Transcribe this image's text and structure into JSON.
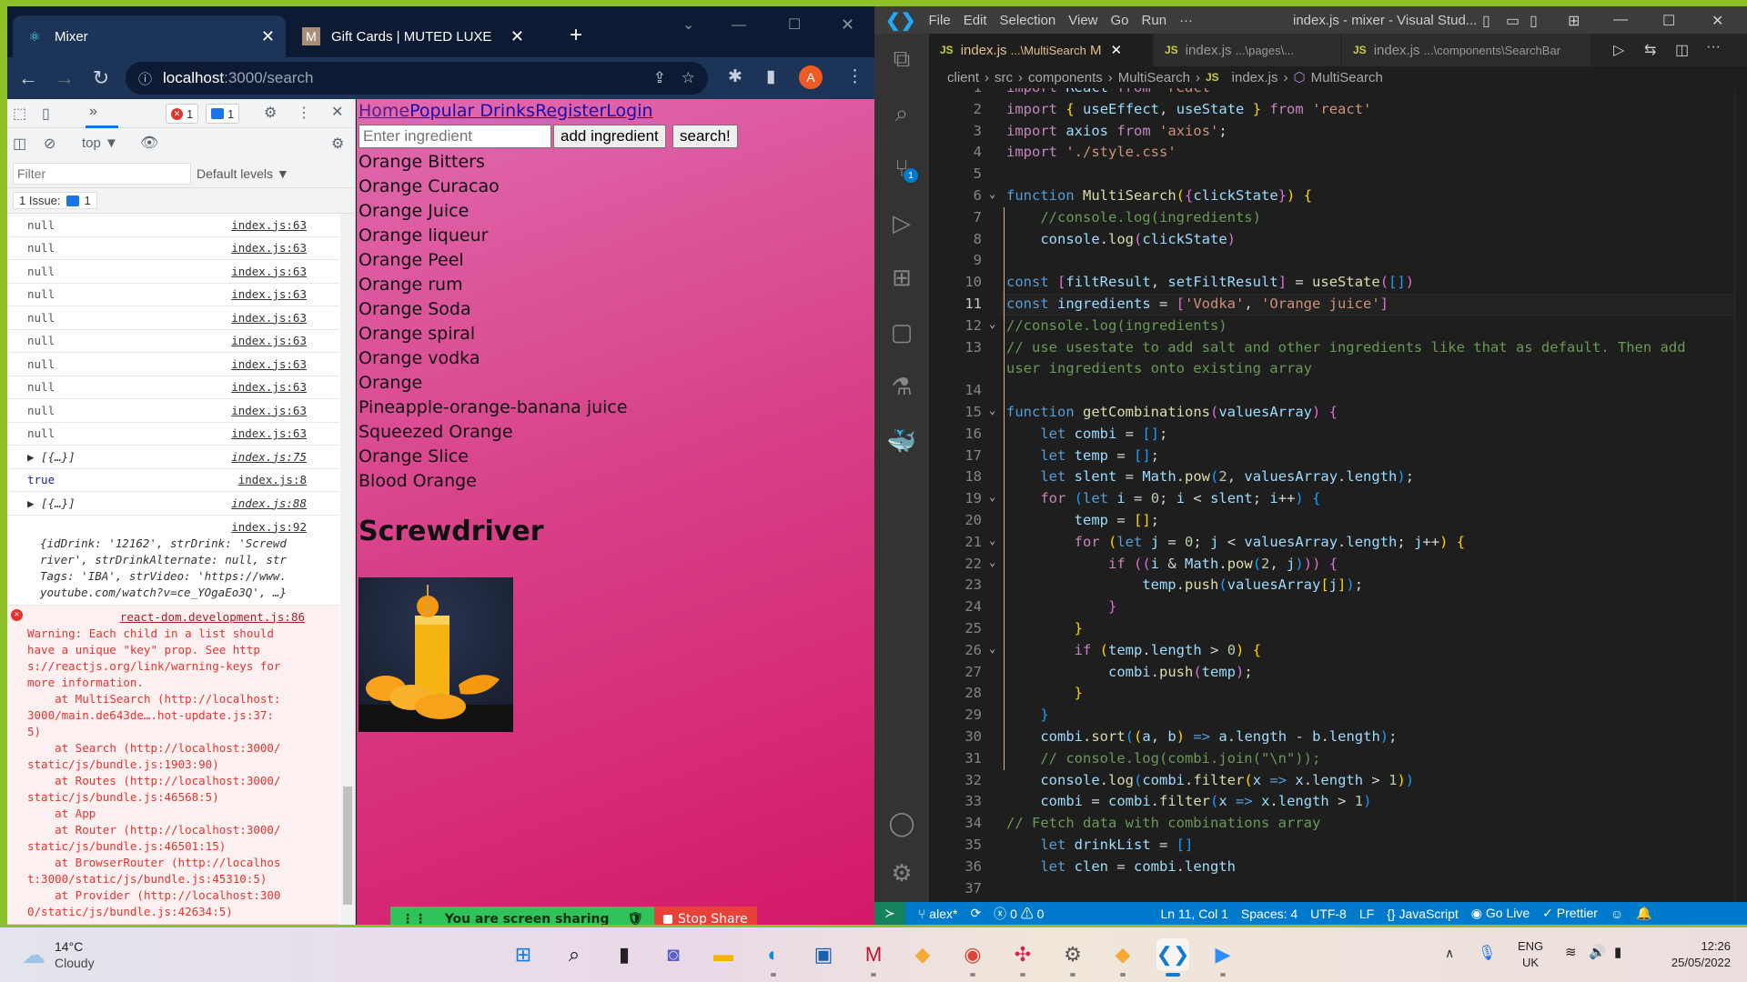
{
  "browser": {
    "tabs": [
      {
        "title": "Mixer",
        "icon": "react-icon",
        "active": true
      },
      {
        "title": "Gift Cards | MUTED LUXE",
        "icon": "muted-luxe-icon",
        "active": false
      }
    ],
    "new_tab": "+",
    "url_host": "localhost",
    "url_path": ":3000/search",
    "profile_initial": "A"
  },
  "devtools": {
    "more_tabs": "»",
    "error_count": "1",
    "message_count": "1",
    "context": "top ▼",
    "filter_placeholder": "Filter",
    "levels": "Default levels ▼",
    "issues_label": "1 Issue:",
    "issues_count": "1",
    "logs": [
      {
        "text": "null",
        "src": "index.js:63",
        "kind": "null"
      },
      {
        "text": "null",
        "src": "index.js:63",
        "kind": "null"
      },
      {
        "text": "null",
        "src": "index.js:63",
        "kind": "null"
      },
      {
        "text": "null",
        "src": "index.js:63",
        "kind": "null"
      },
      {
        "text": "null",
        "src": "index.js:63",
        "kind": "null"
      },
      {
        "text": "null",
        "src": "index.js:63",
        "kind": "null"
      },
      {
        "text": "null",
        "src": "index.js:63",
        "kind": "null"
      },
      {
        "text": "null",
        "src": "index.js:63",
        "kind": "null"
      },
      {
        "text": "null",
        "src": "index.js:63",
        "kind": "null"
      },
      {
        "text": "null",
        "src": "index.js:63",
        "kind": "null"
      },
      {
        "text": "▶ [{…}]",
        "src": "index.js:75",
        "kind": "arr"
      },
      {
        "text": "true",
        "src": "index.js:8",
        "kind": "true"
      },
      {
        "text": "▶ [{…}]",
        "src": "index.js:88",
        "kind": "arr"
      }
    ],
    "object_log": {
      "src": "index.js:92",
      "lines": [
        "{idDrink: '12162', strDrink: 'Screwd",
        "river', strDrinkAlternate: null, str",
        "Tags: 'IBA', strVideo: 'https://www.",
        "youtube.com/watch?v=ce_YOgaEo3Q', …}"
      ]
    },
    "error_log": {
      "src": "react-dom.development.js:86",
      "lines": [
        "Warning: Each child in a list should",
        "have a unique \"key\" prop. See http",
        "s://reactjs.org/link/warning-keys for",
        "more information.",
        "    at MultiSearch (http://localhost:",
        "3000/main.de643de….hot-update.js:37:",
        "5)",
        "    at Search (http://localhost:3000/",
        "static/js/bundle.js:1903:90)",
        "    at Routes (http://localhost:3000/",
        "static/js/bundle.js:46568:5)",
        "    at App",
        "    at Router (http://localhost:3000/",
        "static/js/bundle.js:46501:15)",
        "    at BrowserRouter (http://localhos",
        "t:3000/static/js/bundle.js:45310:5)",
        "    at Provider (http://localhost:300",
        "0/static/js/bundle.js:42634:5)"
      ]
    }
  },
  "page": {
    "nav": [
      "Home",
      "Popular Drinks",
      "Register",
      "Login"
    ],
    "input_placeholder": "Enter ingredient",
    "add_button": "add ingredient",
    "search_button": "search!",
    "results": [
      "Orange Bitters",
      "Orange Curacao",
      "Orange Juice",
      "Orange liqueur",
      "Orange Peel",
      "Orange rum",
      "Orange Soda",
      "Orange spiral",
      "Orange vodka",
      "Orange",
      "Pineapple-orange-banana juice",
      "Squeezed Orange",
      "Orange Slice",
      "Blood Orange"
    ],
    "drink_title": "Screwdriver",
    "share_text": "You are screen sharing",
    "stop_share": "Stop Share"
  },
  "vscode": {
    "menu": [
      "File",
      "Edit",
      "Selection",
      "View",
      "Go",
      "Run",
      "···"
    ],
    "window_title": "index.js - mixer - Visual Stud...",
    "tabs": [
      {
        "name": "index.js",
        "path": "...\\MultiSearch",
        "modified": "M",
        "active": true
      },
      {
        "name": "index.js",
        "path": "...\\pages\\...",
        "active": false
      },
      {
        "name": "index.js",
        "path": "...\\components\\SearchBar",
        "active": false
      }
    ],
    "breadcrumb": [
      "client",
      "src",
      "components",
      "MultiSearch",
      "index.js",
      "MultiSearch"
    ],
    "scm_badge": "1",
    "status": {
      "branch": "alex*",
      "errors": "0",
      "warnings": "0",
      "position": "Ln 11, Col 1",
      "spaces": "Spaces: 4",
      "encoding": "UTF-8",
      "eol": "LF",
      "language": "JavaScript",
      "golive": "Go Live",
      "prettier": "Prettier"
    },
    "current_line": 11
  },
  "taskbar": {
    "weather_temp": "14°C",
    "weather_desc": "Cloudy",
    "lang1": "ENG",
    "lang2": "UK",
    "time": "12:26",
    "date": "25/05/2022"
  }
}
